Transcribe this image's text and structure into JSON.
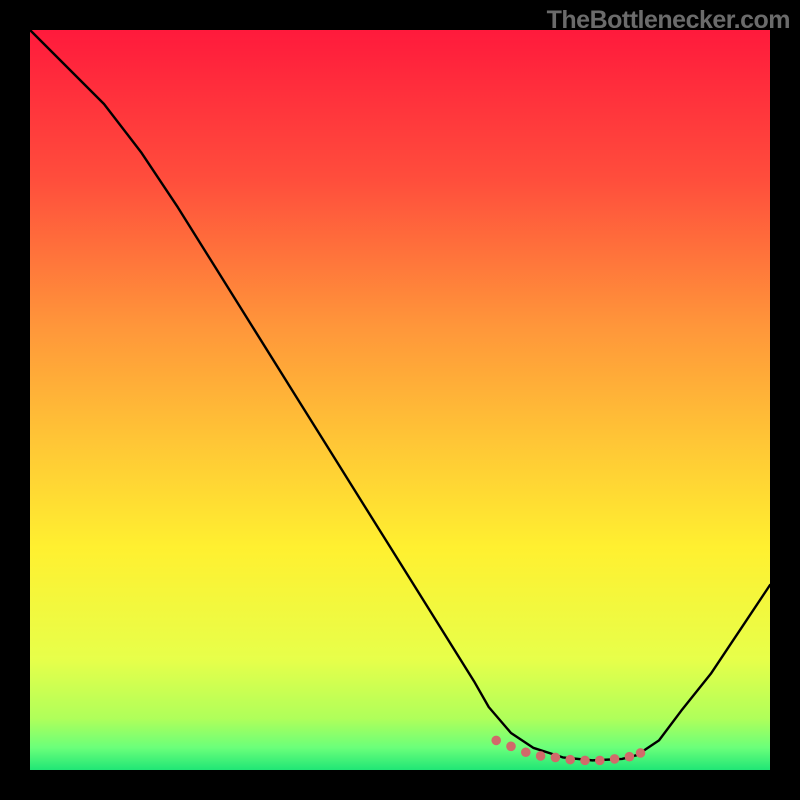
{
  "watermark": "TheBottlenecker.com",
  "chart_data": {
    "type": "line",
    "title": "",
    "xlabel": "",
    "ylabel": "",
    "xlim": [
      0,
      100
    ],
    "ylim": [
      0,
      100
    ],
    "grid": false,
    "background": {
      "type": "vertical-gradient",
      "stops": [
        {
          "offset": 0.0,
          "color": "#ff1a3c"
        },
        {
          "offset": 0.2,
          "color": "#ff4d3c"
        },
        {
          "offset": 0.4,
          "color": "#ff963a"
        },
        {
          "offset": 0.55,
          "color": "#ffc436"
        },
        {
          "offset": 0.7,
          "color": "#fff030"
        },
        {
          "offset": 0.85,
          "color": "#e7ff4a"
        },
        {
          "offset": 0.93,
          "color": "#b0ff5a"
        },
        {
          "offset": 0.97,
          "color": "#6aff7a"
        },
        {
          "offset": 1.0,
          "color": "#20e676"
        }
      ]
    },
    "series": [
      {
        "name": "curve",
        "type": "line",
        "x": [
          0,
          5,
          10,
          15,
          20,
          25,
          30,
          35,
          40,
          45,
          50,
          55,
          60,
          62,
          65,
          68,
          72,
          76,
          80,
          82,
          85,
          88,
          92,
          96,
          100
        ],
        "y": [
          100,
          95,
          90,
          83.5,
          76,
          68,
          60,
          52,
          44,
          36,
          28,
          20,
          12,
          8.5,
          5,
          3,
          1.7,
          1.3,
          1.5,
          2.0,
          4,
          8,
          13,
          19,
          25
        ]
      }
    ],
    "markers": {
      "name": "flat-region",
      "color": "#d16a6a",
      "radius": 4.8,
      "x": [
        63,
        65,
        67,
        69,
        71,
        73,
        75,
        77,
        79,
        81,
        82.5
      ],
      "y": [
        4.0,
        3.2,
        2.4,
        1.9,
        1.7,
        1.4,
        1.3,
        1.3,
        1.5,
        1.8,
        2.3
      ]
    }
  }
}
